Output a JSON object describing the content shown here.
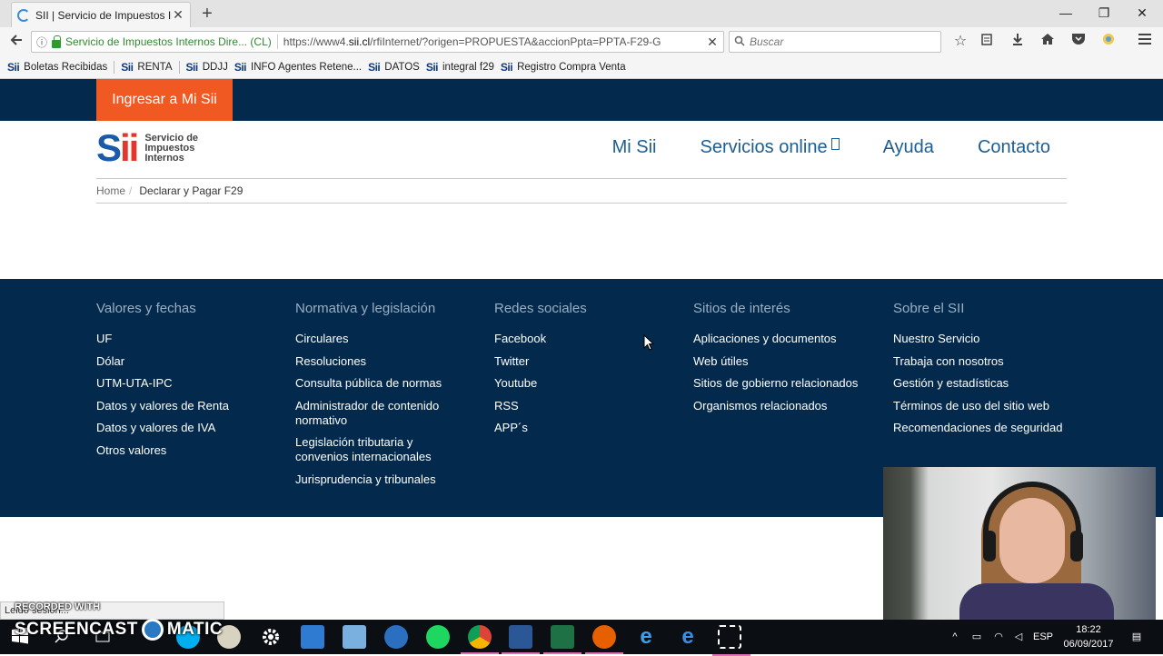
{
  "browser": {
    "tab_title": "SII | Servicio de Impuestos Internos",
    "tab_close": "✕",
    "new_tab": "+",
    "window_controls": [
      "—",
      "❐",
      "✕"
    ],
    "back_icon": "back-arrow-icon",
    "identity_label": "Servicio de Impuestos Internos Dire... (CL)",
    "url_prefix": "https://www4.",
    "url_domain": "sii.cl",
    "url_rest": "/rfiInternet/?origen=PROPUESTA&accionPpta=PPTA-F29-G",
    "stop_icon": "✕",
    "search_placeholder": "Buscar",
    "toolbar_icons": [
      "star-icon",
      "reading-list-icon",
      "download-icon",
      "home-icon",
      "pocket-icon",
      "extension-icon",
      "menu-icon"
    ]
  },
  "bookmarks": [
    {
      "label": "Boletas Recibidas"
    },
    {
      "label": "RENTA"
    },
    {
      "label": "DDJJ"
    },
    {
      "label": "INFO Agentes Retene..."
    },
    {
      "label": "DATOS"
    },
    {
      "label": "integral f29"
    },
    {
      "label": "Registro Compra Venta"
    }
  ],
  "bookmark_icon_text": "Sii",
  "site": {
    "login_button": "Ingresar a Mi Sii",
    "logo_mark": "S",
    "logo_mark_ii": "ii",
    "logo_words": [
      "Servicio de",
      "Impuestos",
      "Internos"
    ],
    "nav": [
      "Mi Sii",
      "Servicios online",
      "Ayuda",
      "Contacto"
    ],
    "breadcrumb": {
      "home": "Home",
      "separator": "/",
      "current": "Declarar y Pagar F29"
    }
  },
  "footer": {
    "columns": [
      {
        "title": "Valores y fechas",
        "links": [
          "UF",
          "Dólar",
          "UTM-UTA-IPC",
          "Datos y valores de Renta",
          "Datos y valores de IVA",
          "Otros valores"
        ]
      },
      {
        "title": "Normativa y legislación",
        "links": [
          "Circulares",
          "Resoluciones",
          "Consulta pública de normas",
          "Administrador de contenido normativo",
          "Legislación tributaria y convenios internacionales",
          "Jurisprudencia y tribunales"
        ]
      },
      {
        "title": "Redes sociales",
        "links": [
          "Facebook",
          "Twitter",
          "Youtube",
          "RSS",
          "APP´s"
        ]
      },
      {
        "title": "Sitios de interés",
        "links": [
          "Aplicaciones y documentos",
          "Web útiles",
          "Sitios de gobierno relacionados",
          "Organismos relacionados"
        ]
      },
      {
        "title": "Sobre el SII",
        "links": [
          "Nuestro Servicio",
          "Trabaja con nosotros",
          "Gestión y estadísticas",
          "Términos de uso del sitio web",
          "Recomendaciones de seguridad"
        ]
      }
    ]
  },
  "statusbar": {
    "text": "Leido sesion..."
  },
  "watermark": {
    "line1": "RECORDED WITH",
    "line2a": "SCREENCAST",
    "line2b": "MATIC"
  },
  "taskbar": {
    "language": "ESP",
    "time": "18:22",
    "date": "06/09/2017",
    "apps": [
      "windows-start-icon",
      "search-icon",
      "task-view-icon",
      "skype-icon",
      "paint-icon",
      "settings-icon",
      "mail-icon",
      "scanner-icon",
      "outlook-icon",
      "spotify-icon",
      "chrome-icon",
      "word-icon",
      "excel-icon",
      "firefox-icon",
      "internet-explorer-icon",
      "edge-icon",
      "snipping-tool-icon"
    ]
  },
  "colors": {
    "site_navy": "#032a4c",
    "login_orange": "#f05a22",
    "nav_blue": "#1a5e94",
    "footer_heading": "#9aaec3",
    "secure_green": "#2e8b2e"
  }
}
